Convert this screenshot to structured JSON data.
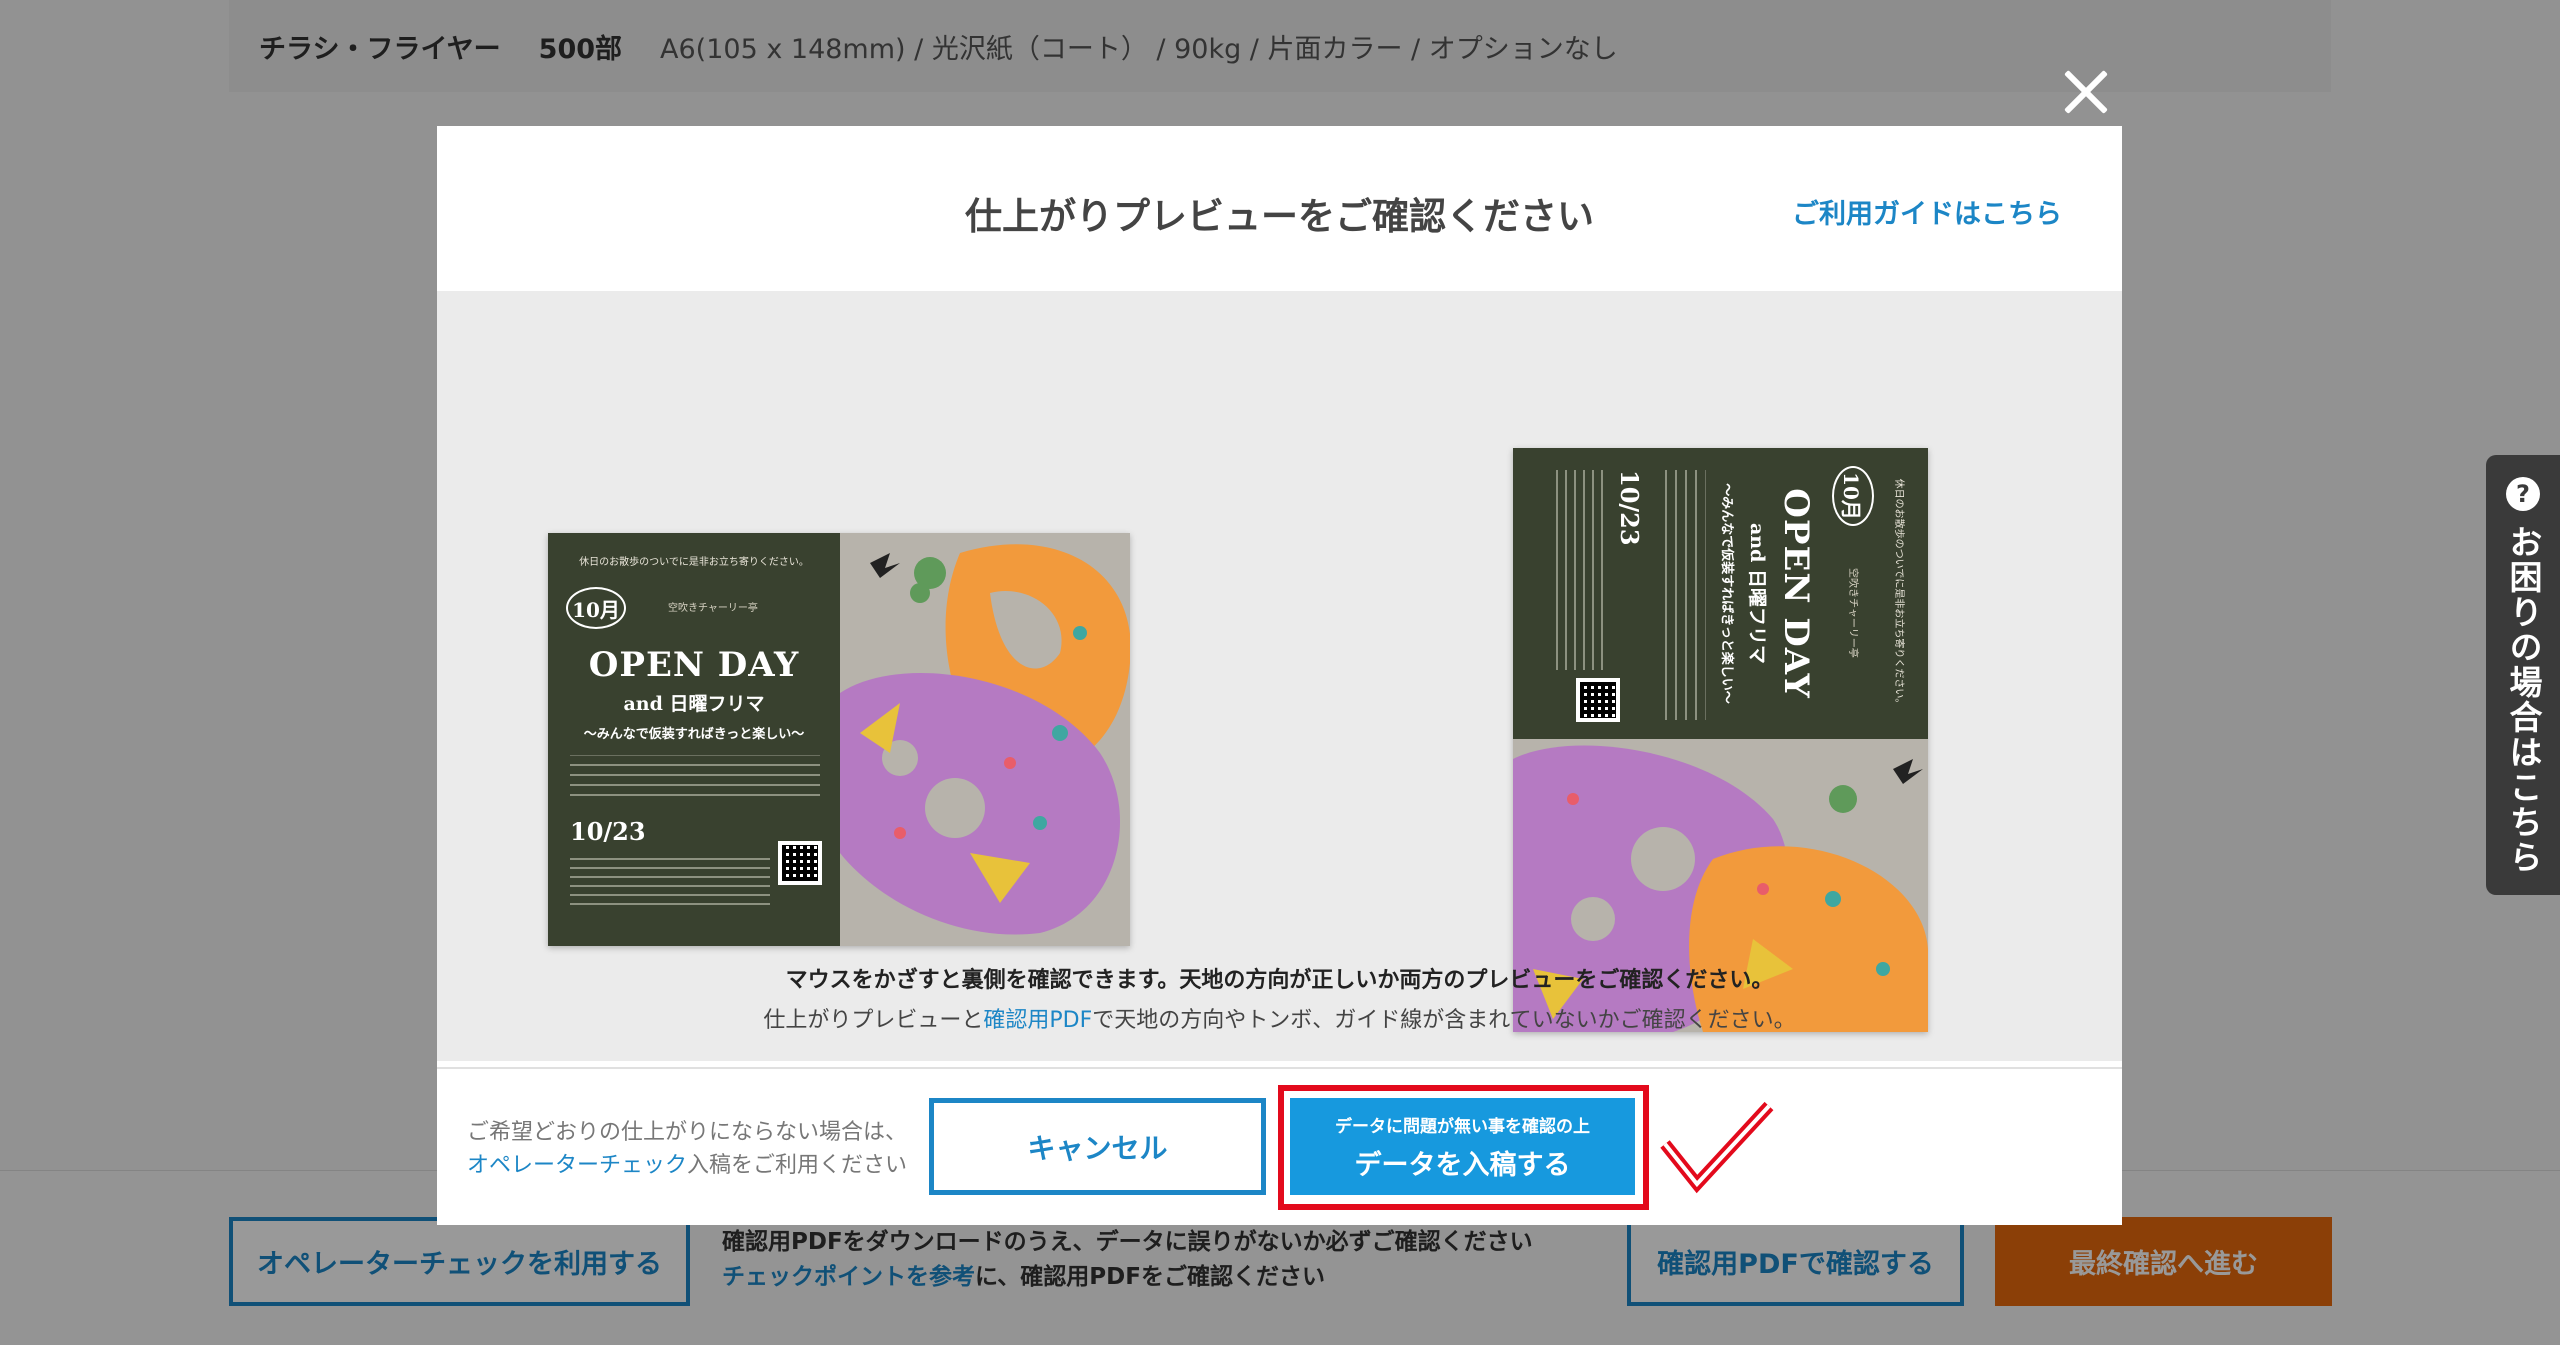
{
  "order": {
    "product": "チラシ・フライヤー",
    "quantity": "500部",
    "spec": "A6(105 x 148mm) / 光沢紙（コート） / 90kg / 片面カラー / オプションなし"
  },
  "bottom": {
    "operator_btn": "オペレーターチェックを利用する",
    "text_line1": "確認用PDFをダウンロードのうえ、データに誤りがないか必ずご確認ください",
    "text_line2_link": "チェックポイントを参考",
    "text_line2_rest": "に、確認用PDFをご確認ください",
    "pdf_btn": "確認用PDFで確認する",
    "final_btn": "最終確認へ進む"
  },
  "modal": {
    "title": "仕上がりプレビューをご確認ください",
    "guide_link": "ご利用ガイドはこちら",
    "notice1": "マウスをかざすと裏側を確認できます。天地の方向が正しいか両方のプレビューをご確認ください。",
    "notice2_a": "仕上がりプレビューと",
    "notice2_link": "確認用PDF",
    "notice2_b": "で天地の方向やトンボ、ガイド線が含まれていないかご確認ください。",
    "footer_line1": "ご希望どおりの仕上がりにならない場合は、",
    "footer_link": "オペレーターチェック",
    "footer_line2_rest": "入稿をご利用ください",
    "cancel_btn": "キャンセル",
    "submit_small": "データに問題が無い事を確認の上",
    "submit_big": "データを入稿する"
  },
  "flyer": {
    "top": "休日のお散歩のついでに是非お立ち寄りください。",
    "month": "10月",
    "logo": "空吹きチャーリー亭",
    "open_day": "OPEN DAY",
    "and_line": "and 日曜フリマ",
    "sub": "〜みんなで仮装すればきっと楽しい〜",
    "date": "10/23"
  },
  "help": {
    "q": "?",
    "label": "お困りの場合はこちら"
  },
  "colors": {
    "accent_blue": "#1c86c6",
    "submit_blue": "#1799de",
    "highlight_red": "#e30a1c",
    "final_orange": "#e8690c",
    "flyer_green": "#39412f"
  }
}
